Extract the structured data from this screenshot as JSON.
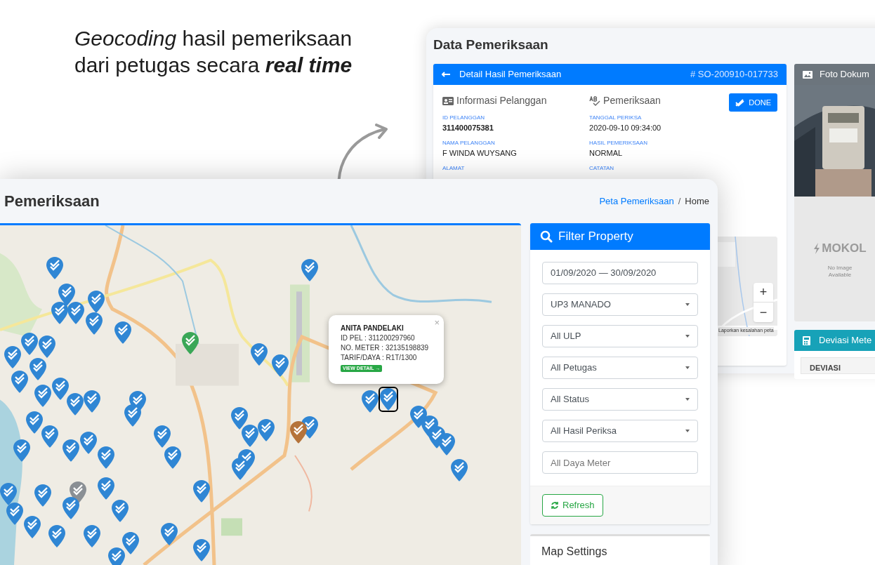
{
  "headline": {
    "line_1": "*Geocoding* hasil pemeriksaan",
    "line_2": "dari petugas secara **real time**"
  },
  "detail_window": {
    "title": "Data Pemeriksaan",
    "detail_card": {
      "title": "Detail Hasil Pemeriksaan",
      "code": "# SO-200910-017733",
      "section_1": "Informasi Pelanggan",
      "section_2": "Pemeriksaan",
      "done_button": "DONE",
      "fields_1": [
        {
          "label": "ID PELANGGAN",
          "value": "311400075381",
          "bold": true
        },
        {
          "label": "NAMA PELANGGAN",
          "value": "F WINDA WUYSANG",
          "bold": false
        },
        {
          "label": "ALAMAT"
        }
      ],
      "fields_2": [
        {
          "label": "TANGGAL PERIKSA",
          "value": "2020-09-10 09:34:00",
          "bold": false
        },
        {
          "label": "HASIL PEMERIKSAAN",
          "value": "NORMAL",
          "bold": false
        },
        {
          "label": "CATATAN"
        }
      ],
      "mini_map": {
        "zoom_in": "+",
        "zoom_out": "−",
        "report_link": "Laporkan kesalahan peta"
      }
    },
    "photo_card": {
      "title": "Foto Dokum",
      "logo": "MOKOL",
      "no_image": "No Image Available"
    },
    "deviation_card": {
      "title": "Deviasi Mete",
      "column_1": "DEVIASI"
    }
  },
  "map_window": {
    "title": "Pemeriksaan",
    "breadcrumb_separator": "/",
    "breadcrumb": [
      {
        "label": "Peta Pemeriksaan",
        "selected": false
      },
      {
        "label": "Home",
        "selected": true
      }
    ],
    "popup": {
      "name": "ANITA PANDELAKI",
      "lines": [
        "ID PEL : 311200297960",
        "NO. METER : 32135198839",
        "TARIF/DAYA : R1T/1300"
      ],
      "button": "VIEW DETAIL →",
      "close": "×"
    },
    "markers": [
      {
        "color": "#2f86d4",
        "selected": false
      },
      {
        "color": "#2f86d4",
        "selected": false
      },
      {
        "color": "#2f86d4",
        "selected": false
      },
      {
        "color": "#2f86d4",
        "selected": false
      },
      {
        "color": "#2f86d4",
        "selected": false
      },
      {
        "color": "#2f86d4",
        "selected": false
      },
      {
        "color": "#2f86d4",
        "selected": false
      },
      {
        "color": "#2f86d4",
        "selected": false
      },
      {
        "color": "#2f86d4",
        "selected": false
      },
      {
        "color": "#2f86d4",
        "selected": false
      },
      {
        "color": "#2f86d4",
        "selected": false
      },
      {
        "color": "#2f86d4",
        "selected": false
      },
      {
        "color": "#3aa757",
        "selected": false
      },
      {
        "color": "#2f86d4",
        "selected": false
      },
      {
        "color": "#2f86d4",
        "selected": false
      },
      {
        "color": "#2f86d4",
        "selected": false
      },
      {
        "color": "#2f86d4",
        "selected": false
      },
      {
        "color": "#2f86d4",
        "selected": false
      },
      {
        "color": "#2f86d4",
        "selected": false
      },
      {
        "color": "#2f86d4",
        "selected": false
      },
      {
        "color": "#2f86d4",
        "selected": false
      },
      {
        "color": "#2f86d4",
        "selected": false
      },
      {
        "color": "#2f86d4",
        "selected": false
      },
      {
        "color": "#2f86d4",
        "selected": false
      },
      {
        "color": "#2f86d4",
        "selected": false
      },
      {
        "color": "#2f86d4",
        "selected": false
      },
      {
        "color": "#2f86d4",
        "selected": false
      },
      {
        "color": "#2f86d4",
        "selected": false
      },
      {
        "color": "#2f86d4",
        "selected": false
      },
      {
        "color": "#2f86d4",
        "selected": false
      },
      {
        "color": "#2f86d4",
        "selected": false
      },
      {
        "color": "#2f86d4",
        "selected": false
      },
      {
        "color": "#2f86d4",
        "selected": false
      },
      {
        "color": "#2f86d4",
        "selected": false
      },
      {
        "color": "#2f86d4",
        "selected": false
      },
      {
        "color": "#2f86d4",
        "selected": false
      },
      {
        "color": "#b5733a",
        "selected": false
      },
      {
        "color": "#2f86d4",
        "selected": false
      },
      {
        "color": "#2f86d4",
        "selected": true
      },
      {
        "color": "#2f86d4",
        "selected": false
      },
      {
        "color": "#2f86d4",
        "selected": false
      },
      {
        "color": "#2f86d4",
        "selected": false
      },
      {
        "color": "#2f86d4",
        "selected": false
      },
      {
        "color": "#2f86d4",
        "selected": false
      },
      {
        "color": "#2f86d4",
        "selected": false
      },
      {
        "color": "#8a8f94",
        "selected": false
      },
      {
        "color": "#2f86d4",
        "selected": false
      },
      {
        "color": "#2f86d4",
        "selected": false
      },
      {
        "color": "#2f86d4",
        "selected": false
      },
      {
        "color": "#2f86d4",
        "selected": false
      },
      {
        "color": "#2f86d4",
        "selected": false
      },
      {
        "color": "#2f86d4",
        "selected": false
      },
      {
        "color": "#2f86d4",
        "selected": false
      },
      {
        "color": "#2f86d4",
        "selected": false
      },
      {
        "color": "#2f86d4",
        "selected": false
      },
      {
        "color": "#2f86d4",
        "selected": false
      },
      {
        "color": "#2f86d4",
        "selected": false
      },
      {
        "color": "#2f86d4",
        "selected": false
      },
      {
        "color": "#2f86d4",
        "selected": false
      }
    ],
    "filter": {
      "title": "Filter Property",
      "date_range": "01/09/2020 — 30/09/2020",
      "selects": [
        "UP3 MANADO",
        "All ULP",
        "All Petugas",
        "All Status",
        "All Hasil Periksa"
      ],
      "daya_placeholder": "All Daya Meter",
      "refresh_button": "Refresh"
    },
    "map_settings": {
      "title": "Map Settings"
    }
  }
}
